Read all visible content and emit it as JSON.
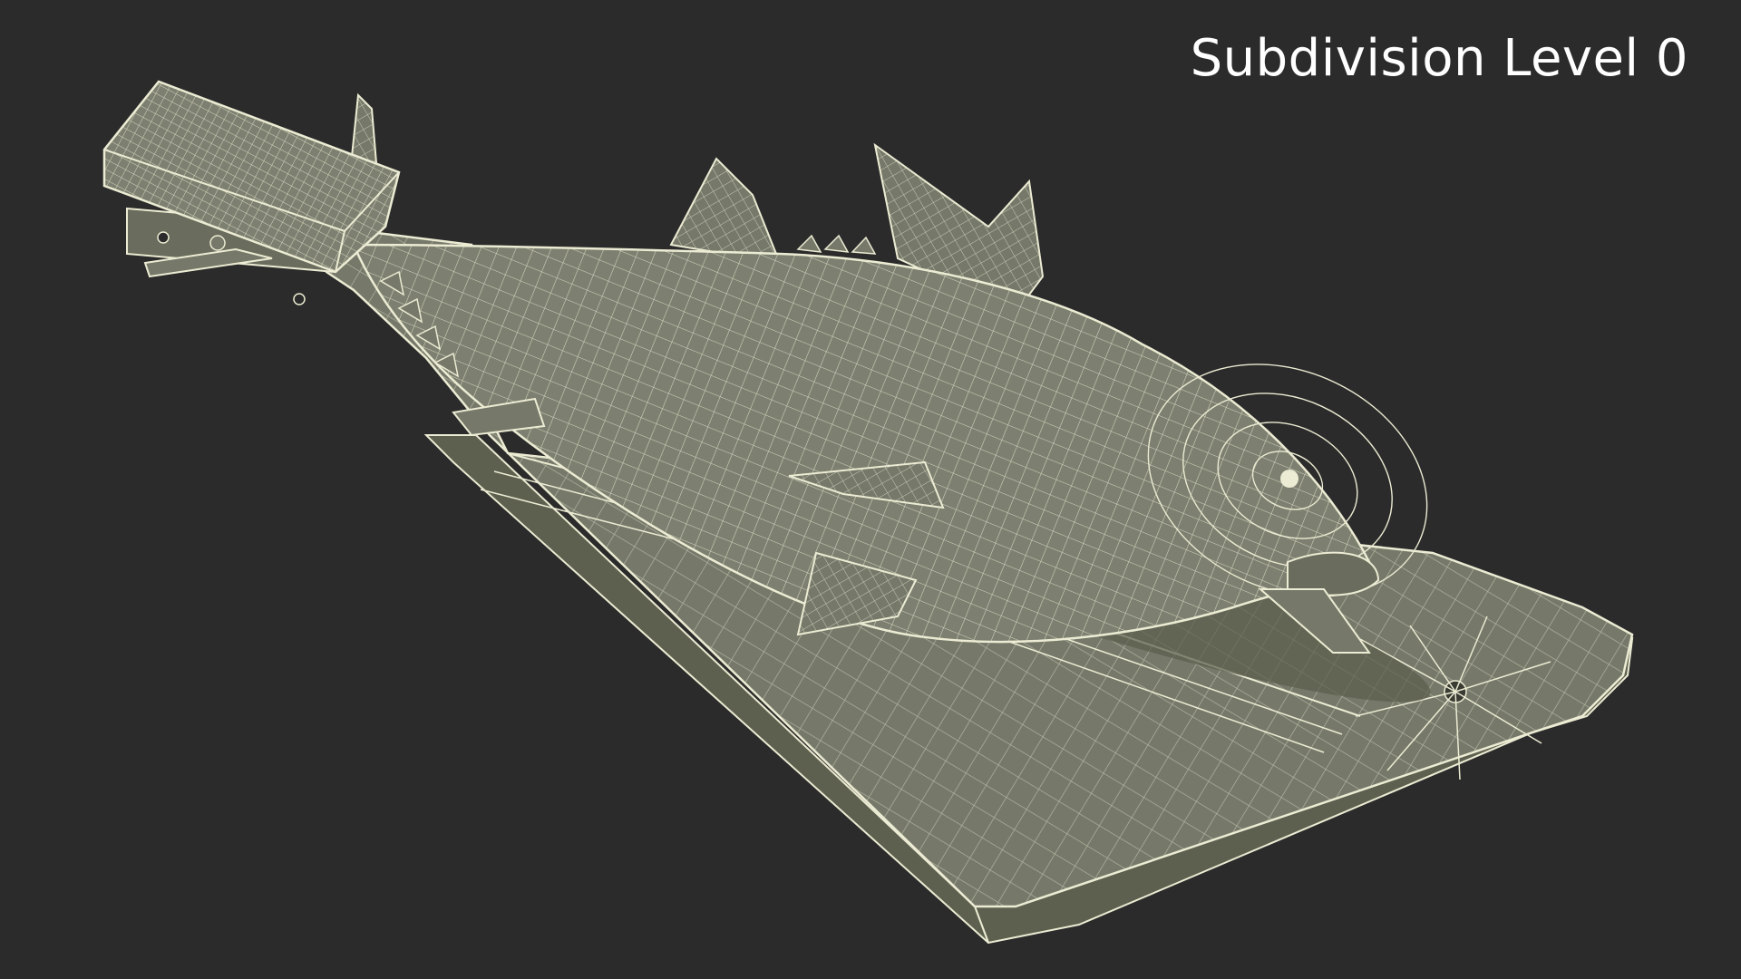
{
  "render": {
    "label": "Subdivision Level 0"
  },
  "colors": {
    "background": "#2b2b2b",
    "surface": "#76796a",
    "surface_dark": "#5d604f",
    "surface_light": "#8e917f",
    "wire": "#ecebd3"
  },
  "model": {
    "subject": "fish-on-cutting-board",
    "display_mode": "wireframe-on-shaded"
  }
}
